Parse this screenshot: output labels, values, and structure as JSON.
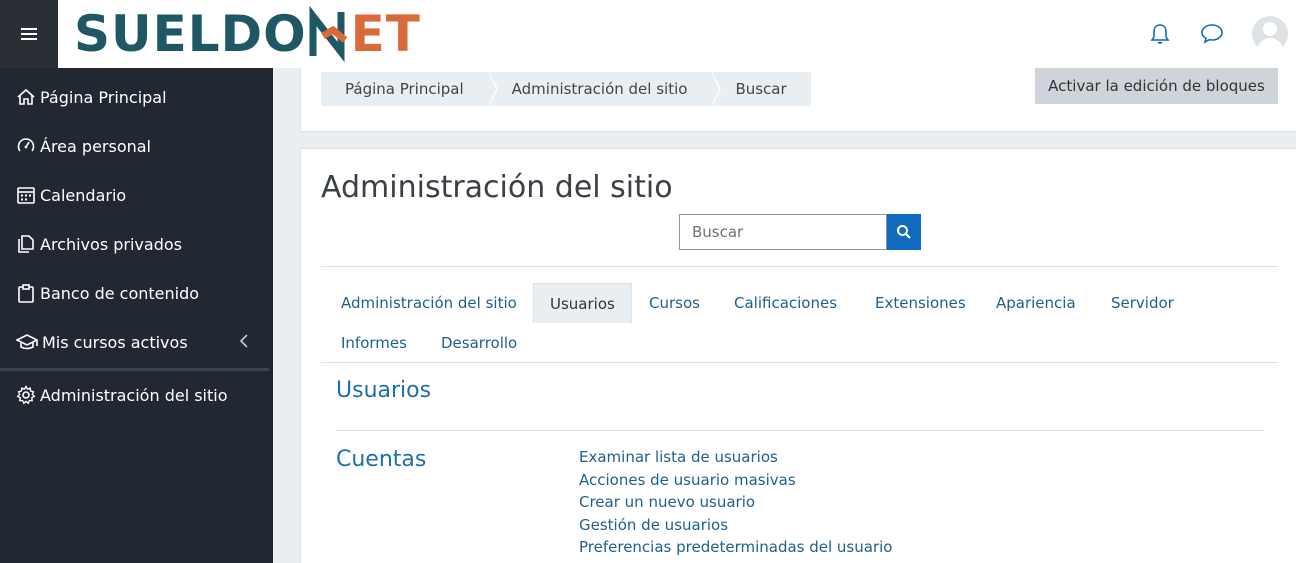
{
  "logo": {
    "left": "SUELDO",
    "right": "ET"
  },
  "sidebar": {
    "items": [
      {
        "label": "Página Principal",
        "icon": "home-icon"
      },
      {
        "label": "Área personal",
        "icon": "dashboard-icon"
      },
      {
        "label": "Calendario",
        "icon": "calendar-icon"
      },
      {
        "label": "Archivos privados",
        "icon": "file-icon"
      },
      {
        "label": "Banco de contenido",
        "icon": "clipboard-icon"
      },
      {
        "label": "Mis cursos activos",
        "icon": "graduation-cap-icon"
      },
      {
        "label": "Administración del sitio",
        "icon": "gear-icon"
      }
    ]
  },
  "breadcrumb": [
    "Página Principal",
    "Administración del sitio",
    "Buscar"
  ],
  "edit_button": "Activar la edición de bloques",
  "page_title": "Administración del sitio",
  "search": {
    "placeholder": "Buscar"
  },
  "tabs": [
    "Administración del sitio",
    "Usuarios",
    "Cursos",
    "Calificaciones",
    "Extensiones",
    "Apariencia",
    "Servidor",
    "Informes",
    "Desarrollo"
  ],
  "section": {
    "title": "Usuarios",
    "category": "Cuentas",
    "links": [
      "Examinar lista de usuarios",
      "Acciones de usuario masivas",
      "Crear un nuevo usuario",
      "Gestión de usuarios",
      "Preferencias predeterminadas del usuario"
    ]
  },
  "colors": {
    "sidebar_bg": "#222831",
    "accent": "#0f6cbf",
    "link": "#1f5f8b",
    "logo_teal": "#1f5864",
    "logo_orange": "#d96a3a"
  }
}
